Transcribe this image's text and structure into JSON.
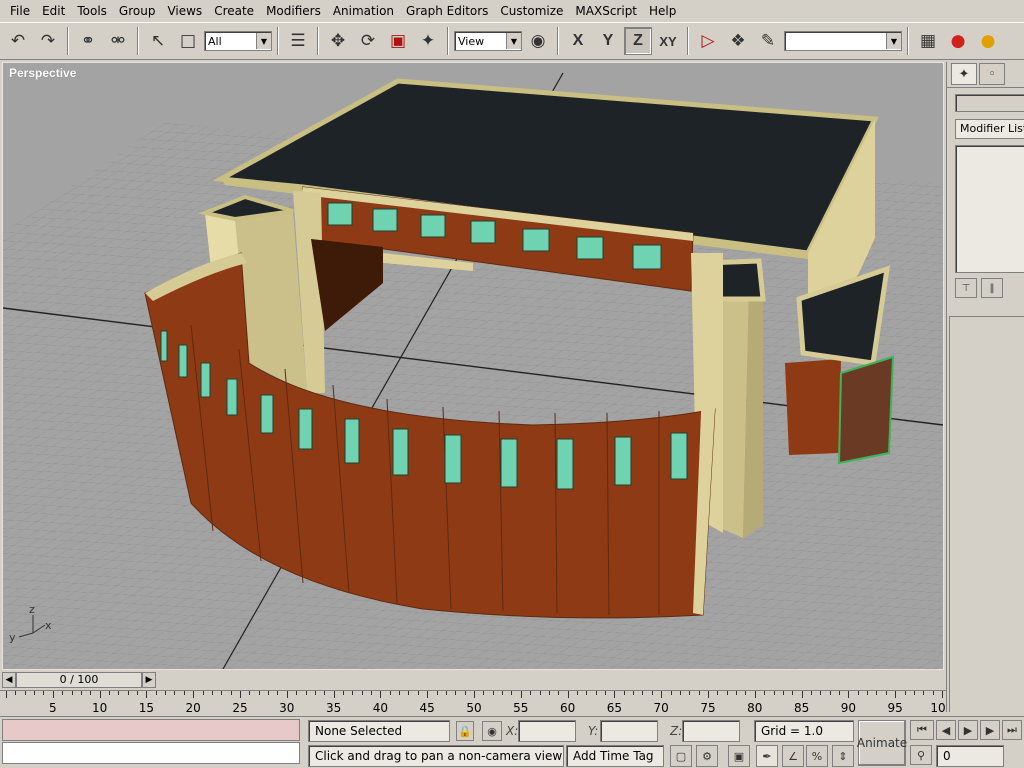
{
  "menu": {
    "items": [
      "File",
      "Edit",
      "Tools",
      "Group",
      "Views",
      "Create",
      "Modifiers",
      "Animation",
      "Graph Editors",
      "Customize",
      "MAXScript",
      "Help"
    ]
  },
  "toolbar": {
    "selection_filter": "All",
    "coord_system": "View",
    "axis_x": "X",
    "axis_y": "Y",
    "axis_z": "Z",
    "axis_xy": "XY",
    "named_selection": ""
  },
  "viewport": {
    "label": "Perspective",
    "axis_z": "z",
    "axis_y": "y",
    "axis_x": "x"
  },
  "command_panel": {
    "modifier_list": "Modifier List"
  },
  "timeline": {
    "slider_text": "0 / 100",
    "ticks": [
      "5",
      "10",
      "15",
      "20",
      "25",
      "30",
      "35",
      "40",
      "45",
      "50",
      "55",
      "60",
      "65",
      "70",
      "75",
      "80",
      "85",
      "90",
      "95",
      "10"
    ]
  },
  "status": {
    "selection": "None Selected",
    "x_label": "X:",
    "y_label": "Y:",
    "z_label": "Z:",
    "x_value": "",
    "y_value": "",
    "z_value": "",
    "grid": "Grid = 1.0",
    "prompt": "Click and drag to pan a non-camera view",
    "add_time_tag": "Add Time Tag",
    "animate": "Animate",
    "frame": "0"
  },
  "colors": {
    "brick": "#8e3a14",
    "cream": "#d6cb94",
    "roof": "#1e2328",
    "window": "#6fd2b0",
    "grid_bg": "#a3a3a3"
  }
}
